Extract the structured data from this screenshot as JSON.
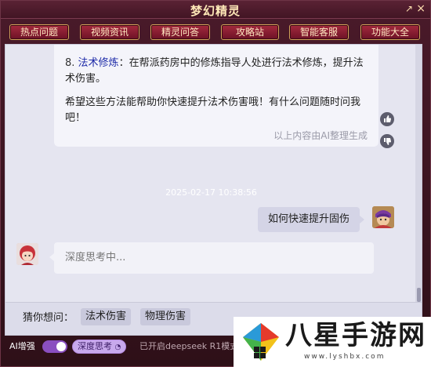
{
  "window": {
    "title": "梦幻精灵",
    "restore_glyph": "↗",
    "close_glyph": "×"
  },
  "nav": [
    {
      "label": "热点问题"
    },
    {
      "label": "视频资讯"
    },
    {
      "label": "精灵问答"
    },
    {
      "label": "攻略站"
    },
    {
      "label": "智能客服"
    },
    {
      "label": "功能大全"
    }
  ],
  "answer": {
    "item_num": "8.",
    "item_term": "法术修炼",
    "item_text": "：在帮派药房中的修炼指导人处进行法术修炼，提升法术伤害。",
    "closing": "希望这些方法能帮助你快速提升法术伤害哦！有什么问题随时问我吧！",
    "footnote": "以上内容由AI整理生成"
  },
  "timestamp": "2025-02-17 10:38:56",
  "user_message": "如何快速提升固伤",
  "ai_pending": "深度思考中...",
  "suggest": {
    "label": "猜你想问：",
    "chips": [
      "法术伤害",
      "物理伤害"
    ]
  },
  "bottom": {
    "ai_label": "AI增强",
    "deep_label": "深度思考",
    "status": "已开启deepseek R1模式"
  },
  "logo": {
    "text": "八星手游网",
    "url": "www.lyshbx.com"
  },
  "colors": {
    "accent": "#a52a3e",
    "term": "#1d2aa8",
    "toggle": "#8a4fc0"
  }
}
